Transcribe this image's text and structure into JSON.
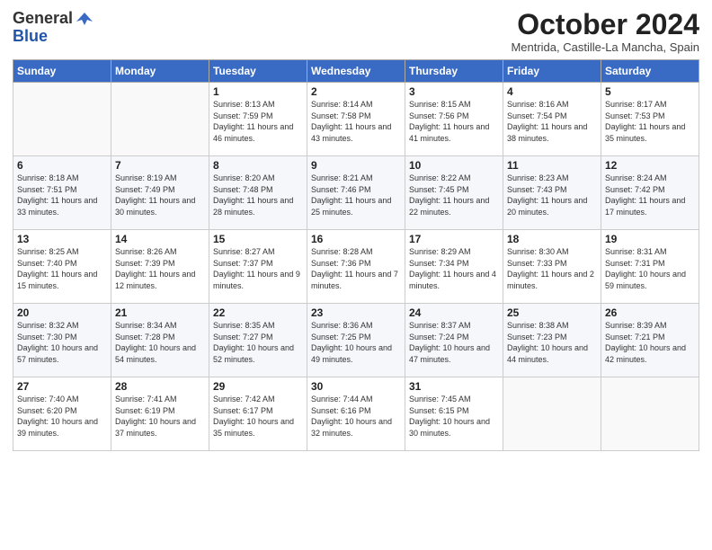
{
  "header": {
    "logo_general": "General",
    "logo_blue": "Blue",
    "month_title": "October 2024",
    "subtitle": "Mentrida, Castille-La Mancha, Spain"
  },
  "days_of_week": [
    "Sunday",
    "Monday",
    "Tuesday",
    "Wednesday",
    "Thursday",
    "Friday",
    "Saturday"
  ],
  "weeks": [
    [
      {
        "day": "",
        "info": ""
      },
      {
        "day": "",
        "info": ""
      },
      {
        "day": "1",
        "info": "Sunrise: 8:13 AM\nSunset: 7:59 PM\nDaylight: 11 hours and 46 minutes."
      },
      {
        "day": "2",
        "info": "Sunrise: 8:14 AM\nSunset: 7:58 PM\nDaylight: 11 hours and 43 minutes."
      },
      {
        "day": "3",
        "info": "Sunrise: 8:15 AM\nSunset: 7:56 PM\nDaylight: 11 hours and 41 minutes."
      },
      {
        "day": "4",
        "info": "Sunrise: 8:16 AM\nSunset: 7:54 PM\nDaylight: 11 hours and 38 minutes."
      },
      {
        "day": "5",
        "info": "Sunrise: 8:17 AM\nSunset: 7:53 PM\nDaylight: 11 hours and 35 minutes."
      }
    ],
    [
      {
        "day": "6",
        "info": "Sunrise: 8:18 AM\nSunset: 7:51 PM\nDaylight: 11 hours and 33 minutes."
      },
      {
        "day": "7",
        "info": "Sunrise: 8:19 AM\nSunset: 7:49 PM\nDaylight: 11 hours and 30 minutes."
      },
      {
        "day": "8",
        "info": "Sunrise: 8:20 AM\nSunset: 7:48 PM\nDaylight: 11 hours and 28 minutes."
      },
      {
        "day": "9",
        "info": "Sunrise: 8:21 AM\nSunset: 7:46 PM\nDaylight: 11 hours and 25 minutes."
      },
      {
        "day": "10",
        "info": "Sunrise: 8:22 AM\nSunset: 7:45 PM\nDaylight: 11 hours and 22 minutes."
      },
      {
        "day": "11",
        "info": "Sunrise: 8:23 AM\nSunset: 7:43 PM\nDaylight: 11 hours and 20 minutes."
      },
      {
        "day": "12",
        "info": "Sunrise: 8:24 AM\nSunset: 7:42 PM\nDaylight: 11 hours and 17 minutes."
      }
    ],
    [
      {
        "day": "13",
        "info": "Sunrise: 8:25 AM\nSunset: 7:40 PM\nDaylight: 11 hours and 15 minutes."
      },
      {
        "day": "14",
        "info": "Sunrise: 8:26 AM\nSunset: 7:39 PM\nDaylight: 11 hours and 12 minutes."
      },
      {
        "day": "15",
        "info": "Sunrise: 8:27 AM\nSunset: 7:37 PM\nDaylight: 11 hours and 9 minutes."
      },
      {
        "day": "16",
        "info": "Sunrise: 8:28 AM\nSunset: 7:36 PM\nDaylight: 11 hours and 7 minutes."
      },
      {
        "day": "17",
        "info": "Sunrise: 8:29 AM\nSunset: 7:34 PM\nDaylight: 11 hours and 4 minutes."
      },
      {
        "day": "18",
        "info": "Sunrise: 8:30 AM\nSunset: 7:33 PM\nDaylight: 11 hours and 2 minutes."
      },
      {
        "day": "19",
        "info": "Sunrise: 8:31 AM\nSunset: 7:31 PM\nDaylight: 10 hours and 59 minutes."
      }
    ],
    [
      {
        "day": "20",
        "info": "Sunrise: 8:32 AM\nSunset: 7:30 PM\nDaylight: 10 hours and 57 minutes."
      },
      {
        "day": "21",
        "info": "Sunrise: 8:34 AM\nSunset: 7:28 PM\nDaylight: 10 hours and 54 minutes."
      },
      {
        "day": "22",
        "info": "Sunrise: 8:35 AM\nSunset: 7:27 PM\nDaylight: 10 hours and 52 minutes."
      },
      {
        "day": "23",
        "info": "Sunrise: 8:36 AM\nSunset: 7:25 PM\nDaylight: 10 hours and 49 minutes."
      },
      {
        "day": "24",
        "info": "Sunrise: 8:37 AM\nSunset: 7:24 PM\nDaylight: 10 hours and 47 minutes."
      },
      {
        "day": "25",
        "info": "Sunrise: 8:38 AM\nSunset: 7:23 PM\nDaylight: 10 hours and 44 minutes."
      },
      {
        "day": "26",
        "info": "Sunrise: 8:39 AM\nSunset: 7:21 PM\nDaylight: 10 hours and 42 minutes."
      }
    ],
    [
      {
        "day": "27",
        "info": "Sunrise: 7:40 AM\nSunset: 6:20 PM\nDaylight: 10 hours and 39 minutes."
      },
      {
        "day": "28",
        "info": "Sunrise: 7:41 AM\nSunset: 6:19 PM\nDaylight: 10 hours and 37 minutes."
      },
      {
        "day": "29",
        "info": "Sunrise: 7:42 AM\nSunset: 6:17 PM\nDaylight: 10 hours and 35 minutes."
      },
      {
        "day": "30",
        "info": "Sunrise: 7:44 AM\nSunset: 6:16 PM\nDaylight: 10 hours and 32 minutes."
      },
      {
        "day": "31",
        "info": "Sunrise: 7:45 AM\nSunset: 6:15 PM\nDaylight: 10 hours and 30 minutes."
      },
      {
        "day": "",
        "info": ""
      },
      {
        "day": "",
        "info": ""
      }
    ]
  ]
}
